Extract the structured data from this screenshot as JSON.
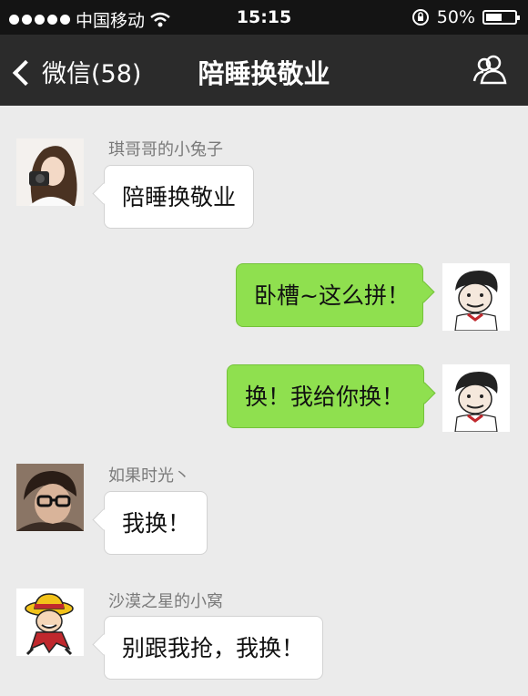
{
  "status_bar": {
    "carrier": "中国移动",
    "time": "15:15",
    "battery": "50%",
    "battery_level": 0.5
  },
  "nav": {
    "back_label": "微信(58)",
    "title": "陪睡换敬业"
  },
  "messages": [
    {
      "sender": "琪哥哥的小兔子",
      "text": "陪睡换敬业",
      "direction": "in"
    },
    {
      "sender": "",
      "text": "卧槽~这么拼！",
      "direction": "out"
    },
    {
      "sender": "",
      "text": "换！我给你换！",
      "direction": "out"
    },
    {
      "sender": "如果时光丶",
      "text": "我换！",
      "direction": "in"
    },
    {
      "sender": "沙漠之星的小窝",
      "text": "别跟我抢，我换！",
      "direction": "in"
    }
  ],
  "colors": {
    "nav_bg": "#2b2b2b",
    "chat_bg": "#ebebeb",
    "outgoing_bubble": "#8fe04f",
    "incoming_bubble": "#ffffff"
  }
}
